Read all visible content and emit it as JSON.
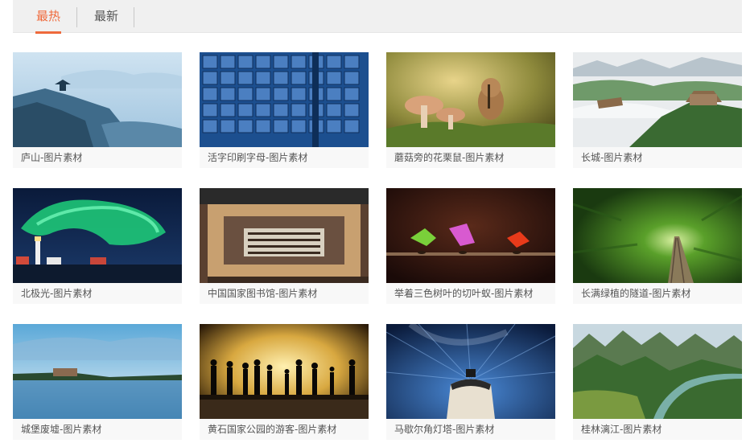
{
  "tabs": [
    {
      "label": "最热",
      "active": true
    },
    {
      "label": "最新",
      "active": false
    }
  ],
  "cards": [
    {
      "caption": "庐山-图片素材"
    },
    {
      "caption": "活字印刷字母-图片素材"
    },
    {
      "caption": "蘑菇旁的花栗鼠-图片素材"
    },
    {
      "caption": "长城-图片素材"
    },
    {
      "caption": "北极光-图片素材"
    },
    {
      "caption": "中国国家图书馆-图片素材"
    },
    {
      "caption": "举着三色树叶的切叶蚁-图片素材"
    },
    {
      "caption": "长满绿植的隧道-图片素材"
    },
    {
      "caption": "城堡废墟-图片素材"
    },
    {
      "caption": "黄石国家公园的游客-图片素材"
    },
    {
      "caption": "马歇尔角灯塔-图片素材"
    },
    {
      "caption": "桂林漓江-图片素材"
    }
  ],
  "accent_color": "#ef6a3c"
}
